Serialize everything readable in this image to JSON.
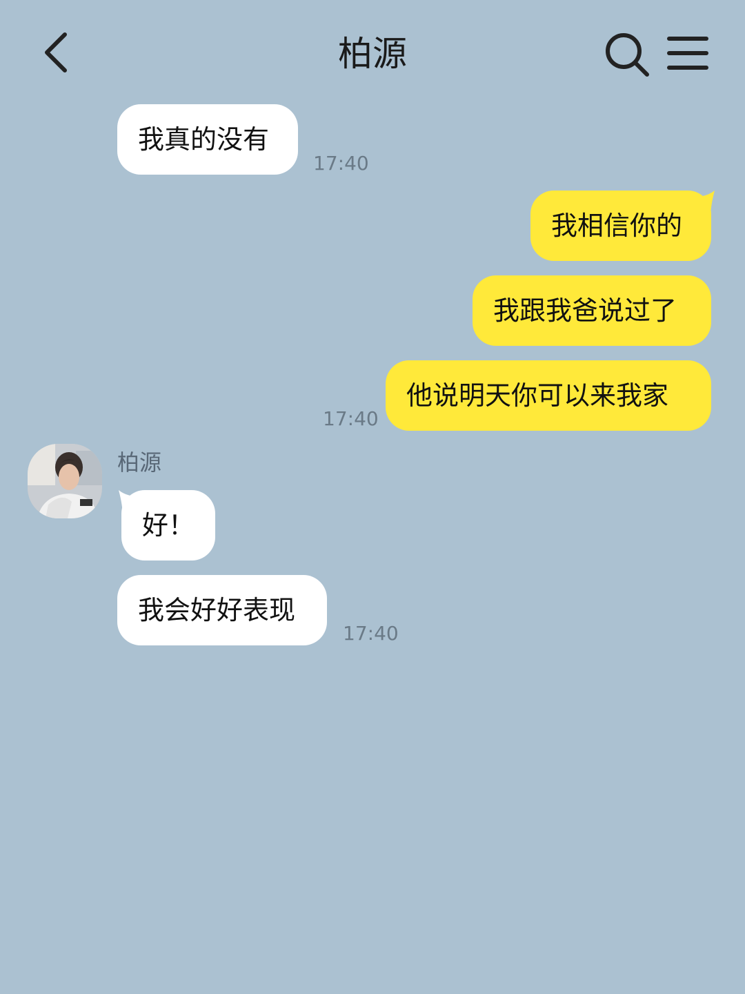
{
  "header": {
    "title": "柏源",
    "back_icon": "chevron-left-icon",
    "search_icon": "search-icon",
    "menu_icon": "hamburger-menu-icon"
  },
  "colors": {
    "background": "#abc1d1",
    "incoming_bubble": "#ffffff",
    "outgoing_bubble": "#ffe93a",
    "time_text": "#6a7a87"
  },
  "messages": [
    {
      "direction": "in",
      "text": "我真的没有"
    },
    {
      "direction": "out",
      "text": "我相信你的"
    },
    {
      "direction": "out",
      "text": "我跟我爸说过了"
    },
    {
      "direction": "out",
      "text": "他说明天你可以来我家"
    },
    {
      "direction": "in",
      "text": "好！"
    },
    {
      "direction": "in",
      "text": "我会好好表现"
    }
  ],
  "timestamps": [
    "17:40",
    "17:40",
    "17:40"
  ],
  "sender": {
    "name": "柏源",
    "avatar_icon": "avatar-icon"
  }
}
